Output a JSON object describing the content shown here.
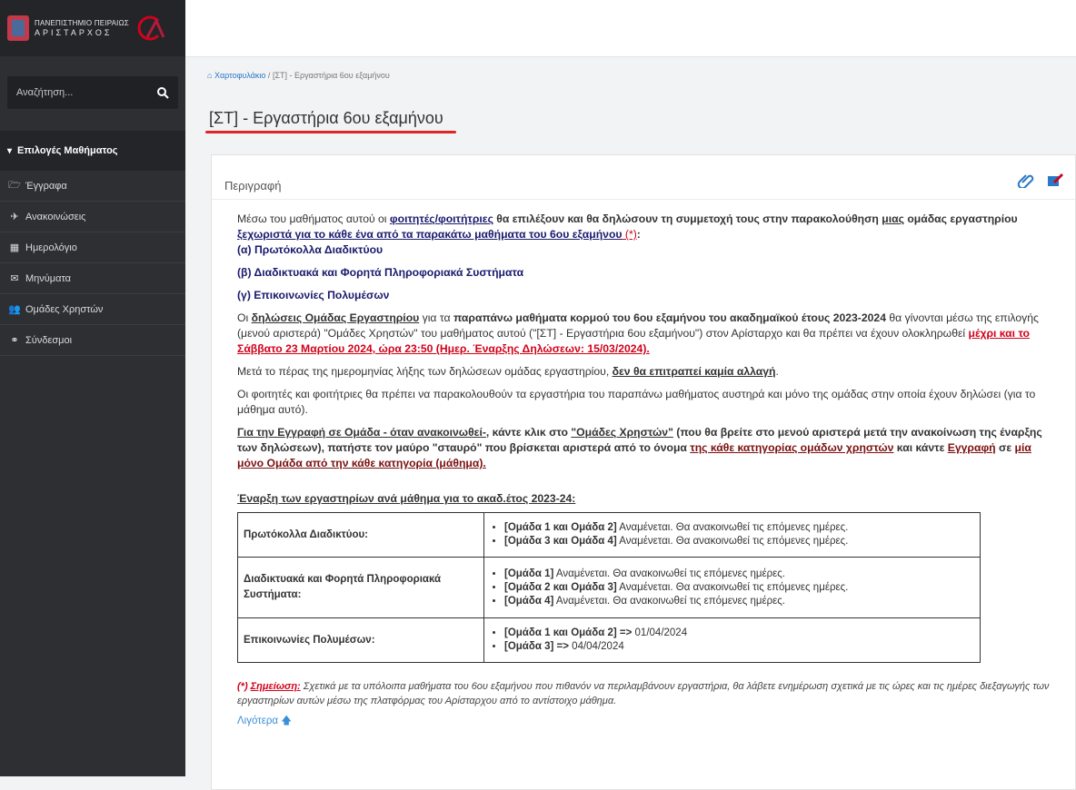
{
  "sidebar": {
    "logo_line1": "ΠΑΝΕΠΙΣΤΗΜΙΟ ΠΕΙΡΑΙΩΣ",
    "logo_line2": "ΑΡΙΣΤΑΡΧΟΣ",
    "search_placeholder": "Αναζήτηση...",
    "menu_header": "Επιλογές Μαθήματος",
    "items": [
      {
        "icon": "folder-icon",
        "label": "Έγγραφα"
      },
      {
        "icon": "megaphone-icon",
        "label": "Ανακοινώσεις"
      },
      {
        "icon": "calendar-icon",
        "label": "Ημερολόγιο"
      },
      {
        "icon": "envelope-icon",
        "label": "Μηνύματα"
      },
      {
        "icon": "users-icon",
        "label": "Ομάδες Χρηστών"
      },
      {
        "icon": "link-icon",
        "label": "Σύνδεσμοι"
      }
    ]
  },
  "breadcrumb": {
    "home": "Χαρτοφυλάκιο",
    "separator": "/",
    "current": "[ΣΤ] - Εργαστήρια 6ου εξαμήνου"
  },
  "page_title": "[ΣΤ] - Εργαστήρια 6ου εξαμήνου",
  "panel": {
    "header": "Περιγραφή",
    "intro_1": "Μέσω του μαθήματος αυτού οι ",
    "intro_2": "φοιτητές/φοιτήτριες",
    "intro_3": " θα επιλέξουν και θα δηλώσουν τη συμμετοχή τους στην παρακολούθηση ",
    "intro_4": "μιας",
    "intro_5": " ομάδας εργαστηρίου ",
    "intro_6": "ξεχωριστά για το κάθε ένα από τα παρακάτω μαθήματα του 6ου εξαμήνου",
    "intro_7": " (*)",
    "intro_8": ":",
    "course_a": "(α) Πρωτόκολλα Διαδικτύου",
    "course_b": "(β) Διαδικτυακά και Φορητά Πληροφοριακά Συστήματα",
    "course_c": "(γ) Επικοινωνίες Πολυμέσων",
    "p2_1": "Οι ",
    "p2_2": "δηλώσεις Ομάδας Εργαστηρίου",
    "p2_3": " για τα ",
    "p2_4": "παραπάνω μαθήματα κορμού του 6ου εξαμήνου του ακαδημαϊκού έτους 2023-2024",
    "p2_5": " θα γίνονται μέσω της επιλογής (μενού αριστερά) \"Ομάδες Χρηστών\" του μαθήματος αυτού (\"[ΣΤ] - Εργαστήρια 6ου εξαμήνου\") στον Αρίσταρχο και θα πρέπει να έχουν ολοκληρωθεί ",
    "p2_6": "μέχρι και το Σάββατο 23 Μαρτίου 2024, ώρα 23:50 (Ημερ. Έναρξης Δηλώσεων: 15/03/2024).",
    "p3_1": "Μετά το πέρας της ημερομηνίας λήξης των δηλώσεων ομάδας εργαστηρίου, ",
    "p3_2": "δεν θα επιτραπεί καμία αλλαγή",
    "p3_3": ".",
    "p4": "Οι φοιτητές και φοιτήτριες θα πρέπει να παρακολουθούν τα εργαστήρια του παραπάνω μαθήματος αυστηρά και μόνο της ομάδας στην οποία έχουν δηλώσει (για το μάθημα αυτό).",
    "p5_1": "Για την Εγγραφή σε Ομάδα - όταν ανακοινωθεί-",
    "p5_2": ", κάντε κλικ στο ",
    "p5_3": "\"Ομάδες Χρηστών\"",
    "p5_4": " (που θα βρείτε στο μενού αριστερά μετά την ανακοίνωση της έναρξης των δηλώσεων), πατήστε τον μαύρο \"σταυρό\" που βρίσκεται αριστερά από το όνομα ",
    "p5_5": "της κάθε κατηγορίας ομάδων χρηστών",
    "p5_6": " και κάντε ",
    "p5_7": "Εγγραφή",
    "p5_8": " σε ",
    "p5_9": "μία μόνο Ομάδα από την κάθε κατηγορία (μάθημα).",
    "start_heading": "Έναρξη των εργαστηρίων ανά μάθημα για το ακαδ.έτος 2023-24:",
    "table": [
      {
        "course": "Πρωτόκολλα Διαδικτύου:",
        "items": [
          {
            "group": "[Ομάδα 1 και Ομάδα 2]",
            "text": " Αναμένεται. Θα ανακοινωθεί τις επόμενες ημέρες."
          },
          {
            "group": "[Ομάδα 3 και Ομάδα 4]",
            "text": " Αναμένεται. Θα ανακοινωθεί τις επόμενες ημέρες."
          }
        ]
      },
      {
        "course": "Διαδικτυακά και Φορητά Πληροφοριακά Συστήματα:",
        "items": [
          {
            "group": "[Ομάδα 1]",
            "text": " Αναμένεται. Θα ανακοινωθεί τις επόμενες ημέρες."
          },
          {
            "group": "[Ομάδα 2 και Ομάδα 3]",
            "text": " Αναμένεται. Θα ανακοινωθεί τις επόμενες ημέρες."
          },
          {
            "group": "[Ομάδα 4]",
            "text": " Αναμένεται. Θα ανακοινωθεί τις επόμενες ημέρες."
          }
        ]
      },
      {
        "course": "Επικοινωνίες Πολυμέσων:",
        "items": [
          {
            "group": "[Ομάδα 1 και Ομάδα 2] =>",
            "text": " 01/04/2024"
          },
          {
            "group": "[Ομάδα 3] =>",
            "text": " 04/04/2024"
          }
        ]
      }
    ],
    "note_1": "(*) ",
    "note_2": "Σημείωση:",
    "note_3": " Σχετικά με τα υπόλοιπα μαθήματα του 6ου εξαμήνου που πιθανόν να περιλαμβάνουν εργαστήρια, θα λάβετε ενημέρωση σχετικά με τις ώρες και τις ημέρες διεξαγωγής των εργαστηρίων αυτών μέσω της πλατφόρμας του Αρίσταρχου από το αντίστοιχο μάθημα.",
    "less": "Λιγότερα"
  },
  "colors": {
    "accent_red": "#e02525",
    "link_blue": "#2b78c5",
    "sidebar_bg": "#2d2f33"
  }
}
